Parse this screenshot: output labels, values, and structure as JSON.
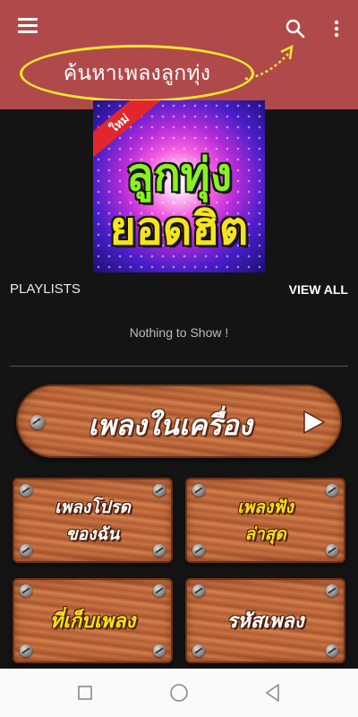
{
  "app_bar": {
    "hint_text": "ค้นหาเพลงลูกทุ่ง",
    "icons": [
      "hamburger-menu-icon",
      "search-icon",
      "more-vert-icon"
    ],
    "colors": {
      "background": "#b04a4a",
      "hint_outline": "#f6e72f"
    }
  },
  "album": {
    "badge": "ใหม่",
    "title_line1": "ลูกทุ่ง",
    "title_line2": "ยอดฮิต"
  },
  "playlists": {
    "label": "PLAYLISTS",
    "view_all": "VIEW ALL",
    "empty_message": "Nothing to Show !"
  },
  "menu": {
    "main_button": "เพลงในเครื่อง",
    "tiles": [
      {
        "lines": [
          "เพลงโปรด",
          "ของฉัน"
        ]
      },
      {
        "lines": [
          "เพลงฟัง",
          "ล่าสุด"
        ]
      },
      {
        "lines": [
          "ที่เก็บเพลง"
        ]
      },
      {
        "lines": [
          "รหัสเพลง"
        ]
      }
    ]
  },
  "nav_bar": {
    "buttons": [
      "recent-apps-icon",
      "home-icon",
      "back-icon"
    ]
  }
}
